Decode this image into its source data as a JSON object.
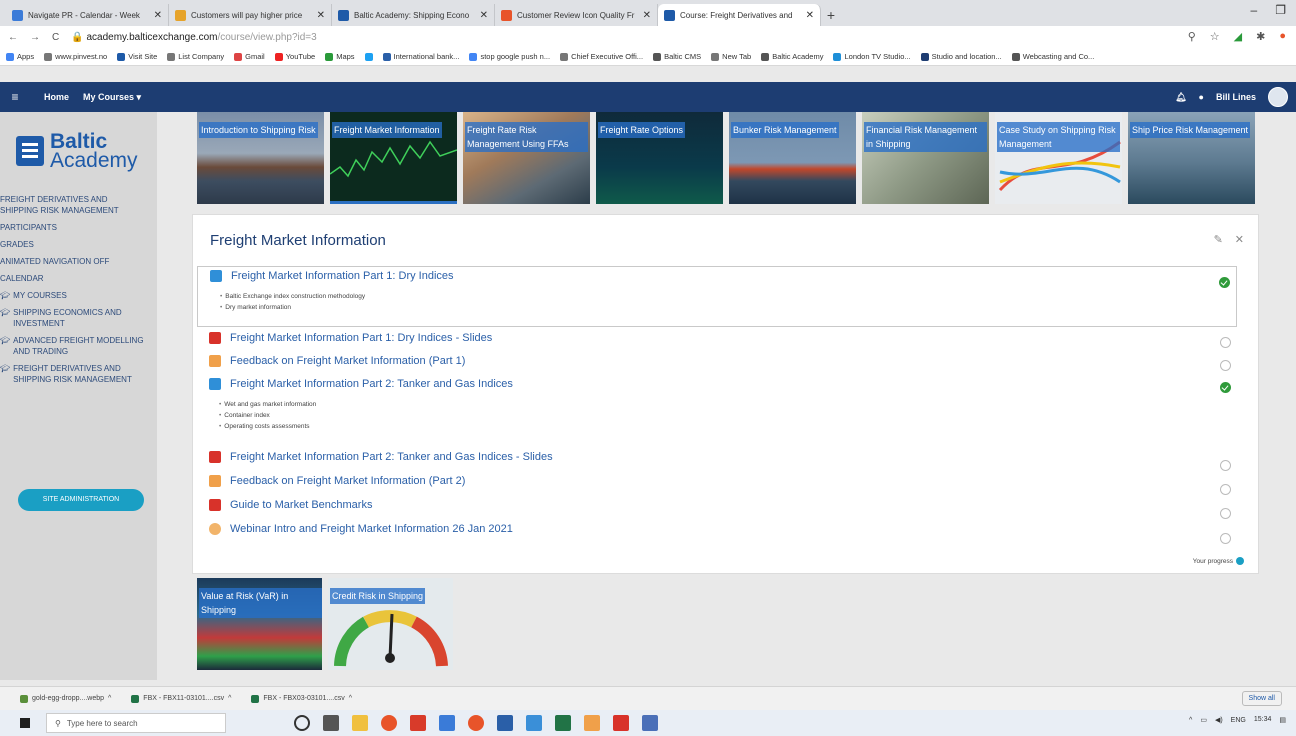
{
  "browser": {
    "tabs": [
      {
        "title": "Navigate PR - Calendar - Week",
        "color": "#3b7bd8"
      },
      {
        "title": "Customers will pay higher price",
        "color": "#e6a32a"
      },
      {
        "title": "Baltic Academy: Shipping Econo",
        "color": "#1e5aa8"
      },
      {
        "title": "Customer Review Icon Quality Fr",
        "color": "#e8542a"
      },
      {
        "title": "Course: Freight Derivatives and",
        "color": "#1e5aa8"
      }
    ],
    "url_main": "academy.balticexchange.com",
    "url_path": "/course/view.php?id=3",
    "bookmarks": [
      "Apps",
      "www.pinvest.no",
      "Visit Site",
      "List Company",
      "Gmail",
      "YouTube",
      "Maps",
      "",
      "International bank...",
      "stop google push n...",
      "Chief Executive Offi...",
      "Baltic CMS",
      "New Tab",
      "Baltic Academy",
      "London TV Studio...",
      "Studio and location...",
      "Webcasting and Co..."
    ]
  },
  "navbar": {
    "home": "Home",
    "my_courses": "My Courses ▾",
    "user": "Bill Lines"
  },
  "logo": {
    "line1": "Baltic",
    "line2": "Academy"
  },
  "sidebar": {
    "course": "FREIGHT DERIVATIVES AND SHIPPING RISK MANAGEMENT",
    "participants": "PARTICIPANTS",
    "grades": "GRADES",
    "animated": "ANIMATED NAVIGATION OFF",
    "calendar": "CALENDAR",
    "my_courses": "MY COURSES",
    "c1": "SHIPPING ECONOMICS AND INVESTMENT",
    "c2": "ADVANCED FREIGHT MODELLING AND TRADING",
    "c3": "FREIGHT DERIVATIVES AND SHIPPING RISK MANAGEMENT",
    "site_admin": "SITE ADMINISTRATION"
  },
  "tiles_top": [
    {
      "label": "Introduction to Shipping Risk"
    },
    {
      "label": "Freight Market Information"
    },
    {
      "label": "Freight Rate Risk Management Using FFAs"
    },
    {
      "label": "Freight Rate Options"
    },
    {
      "label": "Bunker Risk Management"
    },
    {
      "label": "Financial Risk Management in Shipping"
    },
    {
      "label": "Case Study on Shipping Risk Management"
    },
    {
      "label": "Ship Price Risk Management"
    }
  ],
  "panel": {
    "title": "Freight Market Information",
    "progress": "Your progress",
    "activities": [
      {
        "name": "Freight Market Information Part 1: Dry Indices",
        "sub": [
          "Baltic Exchange index construction methodology",
          "Dry market information"
        ],
        "done": true
      },
      {
        "name": "Freight Market Information Part 1: Dry Indices - Slides",
        "done": false
      },
      {
        "name": "Feedback on Freight Market Information (Part 1)",
        "done": false
      },
      {
        "name": "Freight Market Information Part 2: Tanker and Gas Indices",
        "sub": [
          "Wet and gas market information",
          "Container index",
          "Operating costs assessments"
        ],
        "done": true
      },
      {
        "name": "Freight Market Information Part 2: Tanker and Gas Indices - Slides",
        "done": false
      },
      {
        "name": "Feedback on Freight Market Information (Part 2)",
        "done": false
      },
      {
        "name": "Guide to Market Benchmarks",
        "done": false
      },
      {
        "name": "Webinar Intro and Freight Market Information 26 Jan 2021",
        "done": false
      }
    ]
  },
  "tiles_bottom": [
    {
      "label": "Value at Risk (VaR) in Shipping"
    },
    {
      "label": "Credit Risk in Shipping"
    }
  ],
  "downloads": [
    "gold-egg-dropp....webp",
    "FBX - FBX11-03101....csv",
    "FBX - FBX03-03101....csv"
  ],
  "show_all": "Show all",
  "taskbar": {
    "search": "Type here to search",
    "lang": "ENG",
    "time": "15:34"
  }
}
